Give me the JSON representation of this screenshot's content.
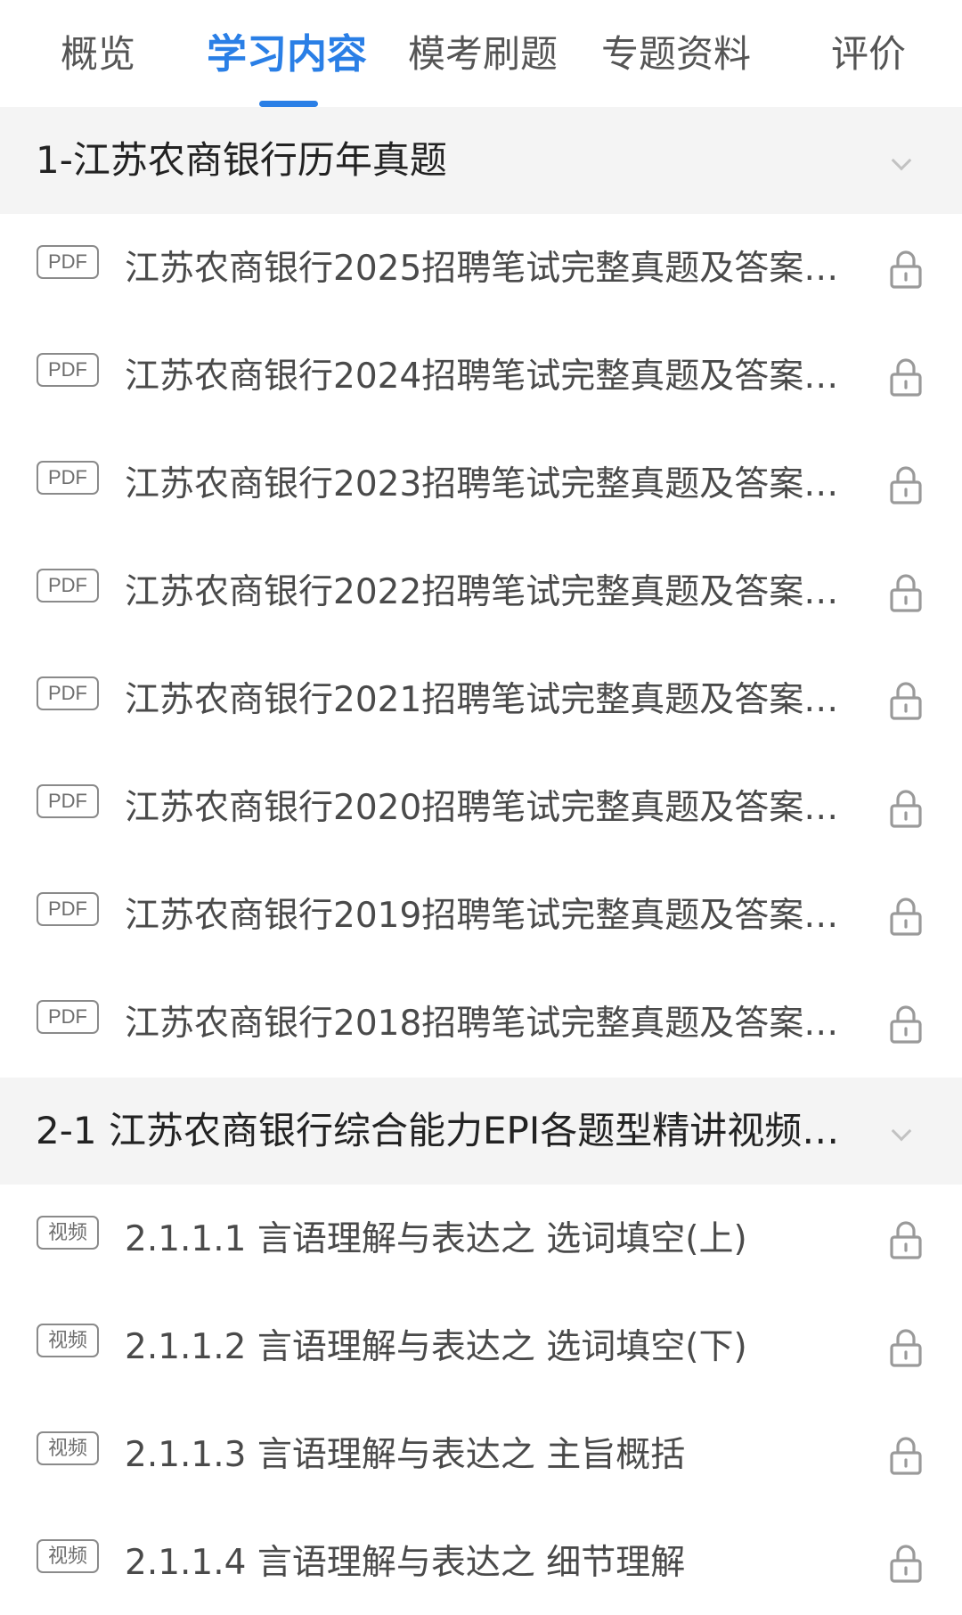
{
  "tabs": [
    {
      "label": "概览",
      "active": false
    },
    {
      "label": "学习内容",
      "active": true
    },
    {
      "label": "模考刷题",
      "active": false
    },
    {
      "label": "专题资料",
      "active": false
    },
    {
      "label": "评价",
      "active": false
    }
  ],
  "colors": {
    "accent": "#2a7fe6",
    "section_bg": "#f4f4f4",
    "text_primary": "#222222",
    "text_secondary": "#4a4a4a",
    "icon_gray": "#9a9a9a"
  },
  "sections": [
    {
      "title": "1-江苏农商银行历年真题",
      "icon": "chevron-down-icon",
      "items": [
        {
          "badge": "PDF",
          "title": "江苏农商银行2025招聘笔试完整真题及答案…",
          "icon": "lock-icon"
        },
        {
          "badge": "PDF",
          "title": "江苏农商银行2024招聘笔试完整真题及答案…",
          "icon": "lock-icon"
        },
        {
          "badge": "PDF",
          "title": "江苏农商银行2023招聘笔试完整真题及答案…",
          "icon": "lock-icon"
        },
        {
          "badge": "PDF",
          "title": "江苏农商银行2022招聘笔试完整真题及答案…",
          "icon": "lock-icon"
        },
        {
          "badge": "PDF",
          "title": "江苏农商银行2021招聘笔试完整真题及答案…",
          "icon": "lock-icon"
        },
        {
          "badge": "PDF",
          "title": "江苏农商银行2020招聘笔试完整真题及答案…",
          "icon": "lock-icon"
        },
        {
          "badge": "PDF",
          "title": "江苏农商银行2019招聘笔试完整真题及答案…",
          "icon": "lock-icon"
        },
        {
          "badge": "PDF",
          "title": "江苏农商银行2018招聘笔试完整真题及答案…",
          "icon": "lock-icon"
        }
      ]
    },
    {
      "title": "2-1 江苏农商银行综合能力EPI各题型精讲视频…",
      "icon": "chevron-down-icon",
      "items": [
        {
          "badge": "视频",
          "title": "2.1.1.1 言语理解与表达之 选词填空(上)",
          "icon": "lock-icon"
        },
        {
          "badge": "视频",
          "title": "2.1.1.2 言语理解与表达之 选词填空(下)",
          "icon": "lock-icon"
        },
        {
          "badge": "视频",
          "title": "2.1.1.3 言语理解与表达之 主旨概括",
          "icon": "lock-icon"
        },
        {
          "badge": "视频",
          "title": "2.1.1.4 言语理解与表达之 细节理解",
          "icon": "lock-icon"
        }
      ]
    }
  ]
}
